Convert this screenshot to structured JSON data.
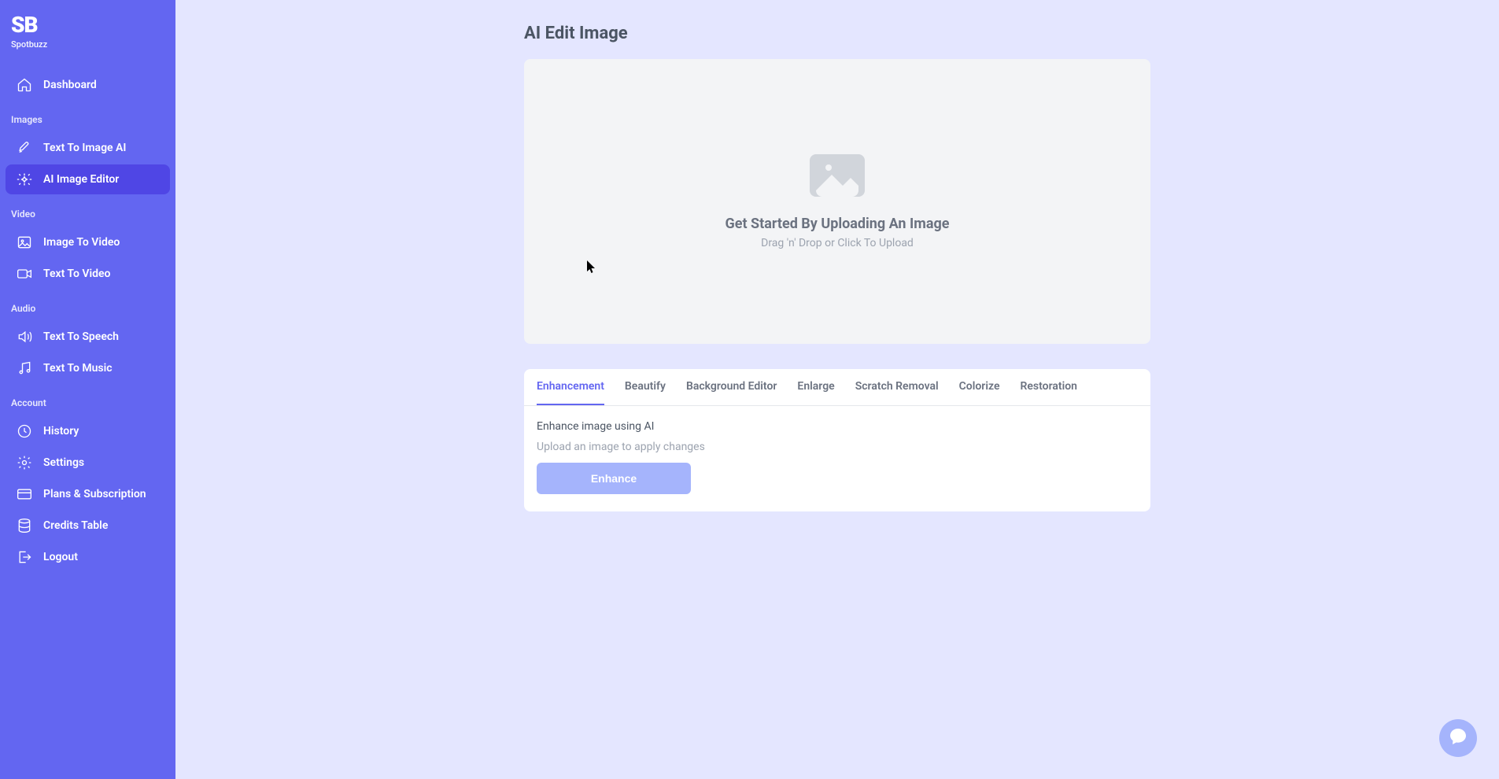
{
  "brand": {
    "logo": "SB",
    "name": "Spotbuzz"
  },
  "sidebar": {
    "top": [
      {
        "label": "Dashboard",
        "icon": "home"
      }
    ],
    "sections": [
      {
        "title": "Images",
        "items": [
          {
            "label": "Text To Image AI",
            "icon": "brush",
            "active": false
          },
          {
            "label": "AI Image Editor",
            "icon": "sparkle",
            "active": true
          }
        ]
      },
      {
        "title": "Video",
        "items": [
          {
            "label": "Image To Video",
            "icon": "image",
            "active": false
          },
          {
            "label": "Text To Video",
            "icon": "video",
            "active": false
          }
        ]
      },
      {
        "title": "Audio",
        "items": [
          {
            "label": "Text To Speech",
            "icon": "speaker",
            "active": false
          },
          {
            "label": "Text To Music",
            "icon": "music",
            "active": false
          }
        ]
      },
      {
        "title": "Account",
        "items": [
          {
            "label": "History",
            "icon": "clock",
            "active": false
          },
          {
            "label": "Settings",
            "icon": "gear",
            "active": false
          },
          {
            "label": "Plans & Subscription",
            "icon": "card",
            "active": false
          },
          {
            "label": "Credits Table",
            "icon": "database",
            "active": false
          },
          {
            "label": "Logout",
            "icon": "logout",
            "active": false
          }
        ]
      }
    ]
  },
  "page": {
    "title": "AI Edit Image",
    "upload": {
      "title": "Get Started By Uploading An Image",
      "subtitle": "Drag 'n' Drop or Click To Upload"
    },
    "tabs": [
      {
        "label": "Enhancement",
        "active": true
      },
      {
        "label": "Beautify",
        "active": false
      },
      {
        "label": "Background Editor",
        "active": false
      },
      {
        "label": "Enlarge",
        "active": false
      },
      {
        "label": "Scratch Removal",
        "active": false
      },
      {
        "label": "Colorize",
        "active": false
      },
      {
        "label": "Restoration",
        "active": false
      }
    ],
    "active_tab": {
      "description": "Enhance image using AI",
      "hint": "Upload an image to apply changes",
      "button": "Enhance"
    }
  }
}
